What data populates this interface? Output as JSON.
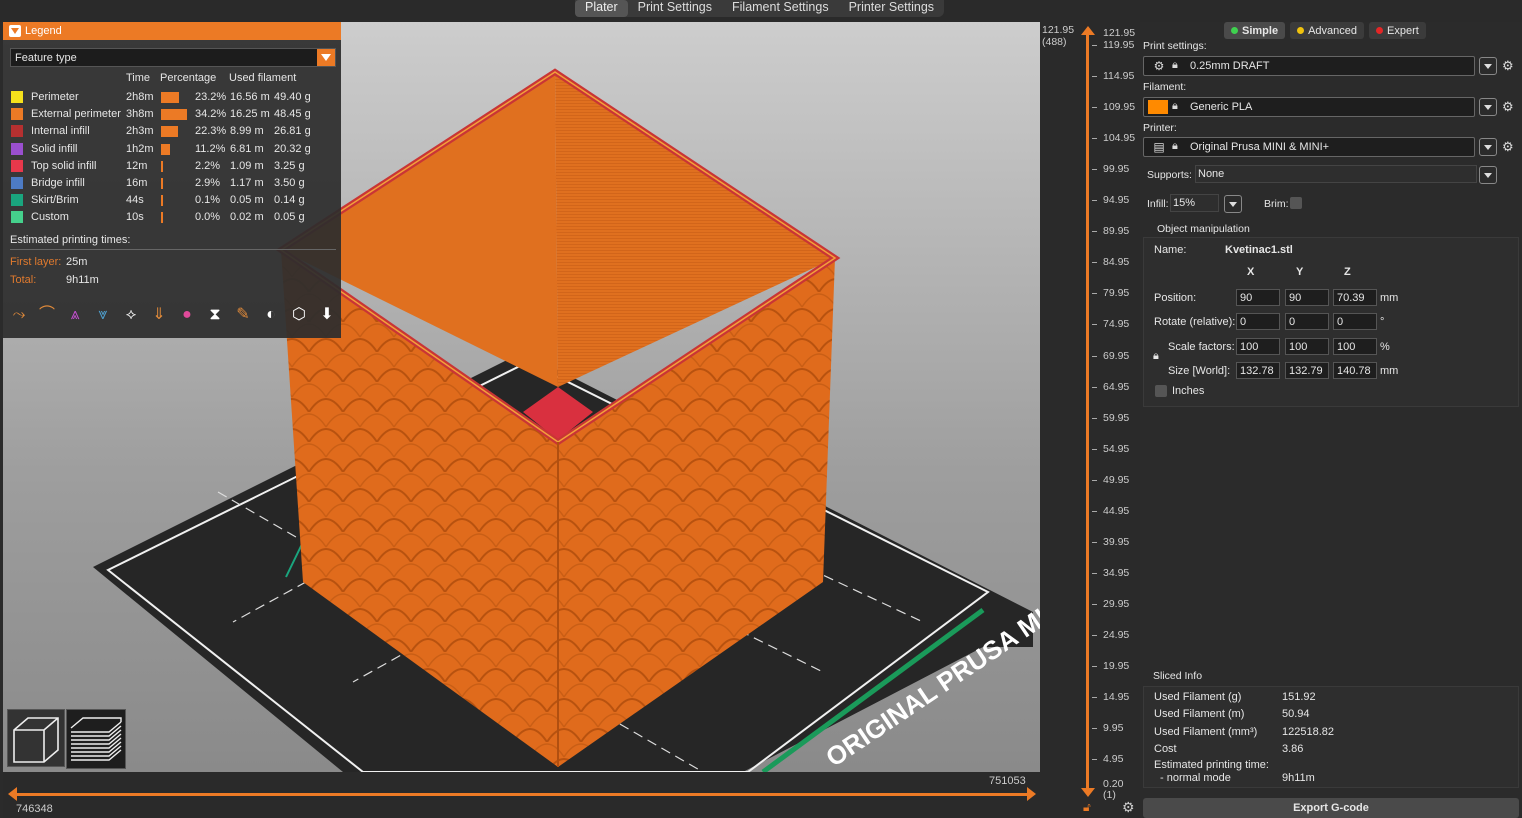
{
  "tabs": [
    {
      "label": "Plater",
      "active": true
    },
    {
      "label": "Print Settings"
    },
    {
      "label": "Filament Settings"
    },
    {
      "label": "Printer Settings"
    }
  ],
  "legend": {
    "title": "Legend",
    "view_type": "Feature type",
    "columns": [
      "Time",
      "Percentage",
      "Used filament"
    ],
    "rows": [
      {
        "name": "Perimeter",
        "color": "#f5e11c",
        "time": "2h8m",
        "pct": "23.2%",
        "pct_value": 23.2,
        "length": "16.56 m",
        "weight": "49.40 g"
      },
      {
        "name": "External perimeter",
        "color": "#ec7a25",
        "time": "3h8m",
        "pct": "34.2%",
        "pct_value": 34.2,
        "length": "16.25 m",
        "weight": "48.45 g"
      },
      {
        "name": "Internal infill",
        "color": "#b63030",
        "time": "2h3m",
        "pct": "22.3%",
        "pct_value": 22.3,
        "length": "8.99 m",
        "weight": "26.81 g"
      },
      {
        "name": "Solid infill",
        "color": "#9a4fcf",
        "time": "1h2m",
        "pct": "11.2%",
        "pct_value": 11.2,
        "length": "6.81 m",
        "weight": "20.32 g"
      },
      {
        "name": "Top solid infill",
        "color": "#e8384b",
        "time": "12m",
        "pct": "2.2%",
        "pct_value": 2.2,
        "length": "1.09 m",
        "weight": "3.25 g"
      },
      {
        "name": "Bridge infill",
        "color": "#4d7bc4",
        "time": "16m",
        "pct": "2.9%",
        "pct_value": 2.9,
        "length": "1.17 m",
        "weight": "3.50 g"
      },
      {
        "name": "Skirt/Brim",
        "color": "#1aa57e",
        "time": "44s",
        "pct": "0.1%",
        "pct_value": 0.1,
        "length": "0.05 m",
        "weight": "0.14 g"
      },
      {
        "name": "Custom",
        "color": "#45d08c",
        "time": "10s",
        "pct": "0.0%",
        "pct_value": 0.0,
        "length": "0.02 m",
        "weight": "0.05 g"
      }
    ],
    "estimated_label": "Estimated printing times:",
    "first_layer_label": "First layer:",
    "first_layer": "25m",
    "total_label": "Total:",
    "total": "9h11m",
    "icons": [
      "travel-icon",
      "wipe-icon",
      "retractions-icon",
      "deretractions-icon",
      "seams-icon",
      "tool-changes-icon",
      "color-changes-icon",
      "pause-prints-icon",
      "custom-gcodes-icon",
      "center-of-gravity-icon",
      "shells-icon",
      "tool-marker-icon"
    ]
  },
  "plate_label": "ORIGINAL PRUSA MINI",
  "hslider": {
    "left_value": "746348",
    "right_value": "751053"
  },
  "vslider": {
    "top_value": "121.95",
    "top_count": "(488)",
    "top_value_right": "121.95",
    "bottom_value": "0.20",
    "bottom_count": "(1)",
    "ticks": [
      "119.95",
      "114.95",
      "109.95",
      "104.95",
      "99.95",
      "94.95",
      "89.95",
      "84.95",
      "79.95",
      "74.95",
      "69.95",
      "64.95",
      "59.95",
      "54.95",
      "49.95",
      "44.95",
      "39.95",
      "34.95",
      "29.95",
      "24.95",
      "19.95",
      "14.95",
      "9.95",
      "4.95"
    ]
  },
  "modes": [
    {
      "label": "Simple",
      "color": "#3fd14f",
      "active": true
    },
    {
      "label": "Advanced",
      "color": "#f0c20d"
    },
    {
      "label": "Expert",
      "color": "#e32626"
    }
  ],
  "print_settings": {
    "label": "Print settings:",
    "value": "0.25mm DRAFT"
  },
  "filament": {
    "label": "Filament:",
    "value": "Generic PLA",
    "color": "#ff8a00"
  },
  "printer": {
    "label": "Printer:",
    "value": "Original Prusa MINI & MINI+"
  },
  "supports": {
    "label": "Supports:",
    "value": "None"
  },
  "infill": {
    "label": "Infill:",
    "value": "15%"
  },
  "brim": {
    "label": "Brim:"
  },
  "object_manipulation": {
    "title": "Object manipulation",
    "name_label": "Name:",
    "name": "Kvetinac1.stl",
    "axes": [
      "X",
      "Y",
      "Z"
    ],
    "position": {
      "label": "Position:",
      "x": "90",
      "y": "90",
      "z": "70.39",
      "unit": "mm"
    },
    "rotate": {
      "label": "Rotate (relative):",
      "x": "0",
      "y": "0",
      "z": "0",
      "unit": "°"
    },
    "scale": {
      "label": "Scale factors:",
      "x": "100",
      "y": "100",
      "z": "100",
      "unit": "%"
    },
    "size": {
      "label": "Size [World]:",
      "x": "132.78",
      "y": "132.79",
      "z": "140.78",
      "unit": "mm"
    },
    "inches_label": "Inches"
  },
  "sliced_info": {
    "title": "Sliced Info",
    "rows": [
      {
        "label": "Used Filament (g)",
        "value": "151.92"
      },
      {
        "label": "Used Filament (m)",
        "value": "50.94"
      },
      {
        "label": "Used Filament (mm³)",
        "value": "122518.82"
      },
      {
        "label": "Cost",
        "value": "3.86"
      }
    ],
    "time_label": "Estimated printing time:",
    "mode_label": "- normal mode",
    "time_value": "9h11m"
  },
  "export_label": "Export G-code"
}
